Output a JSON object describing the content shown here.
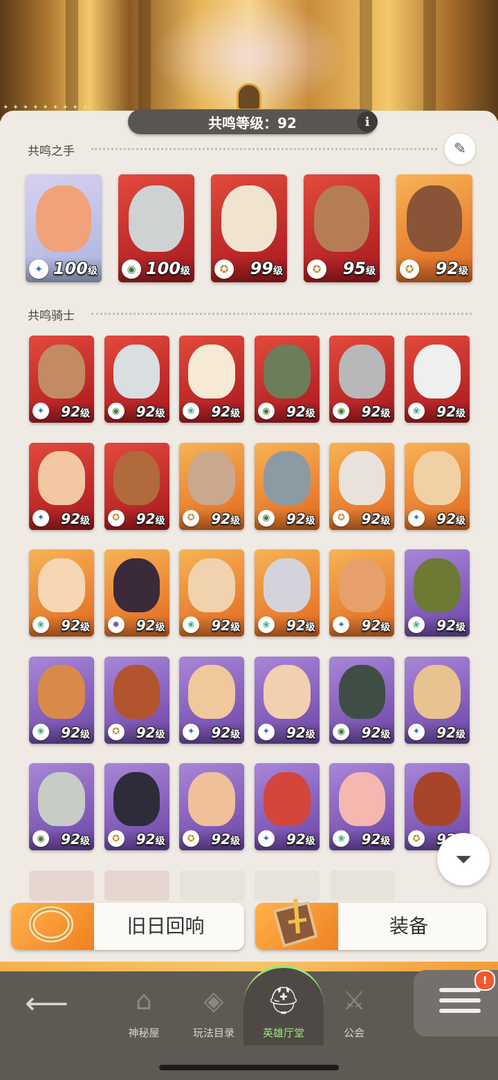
{
  "header": {
    "resonance_label": "共鸣等级：92",
    "info_glyph": "i"
  },
  "sections": {
    "hands_title": "共鸣之手",
    "knights_title": "共鸣骑士"
  },
  "hands": [
    {
      "level": "100",
      "unit": "级",
      "bg": "white",
      "face": "#f2a27a",
      "emblem": "✦",
      "emblem_color": "#3c6dd8"
    },
    {
      "level": "100",
      "unit": "级",
      "bg": "red",
      "face": "#cfd2d3",
      "emblem": "◉",
      "emblem_color": "#4a7a3c"
    },
    {
      "level": "99",
      "unit": "级",
      "bg": "red",
      "face": "#f1e4cf",
      "emblem": "✪",
      "emblem_color": "#c98a2a"
    },
    {
      "level": "95",
      "unit": "级",
      "bg": "red",
      "face": "#b57d56",
      "emblem": "✪",
      "emblem_color": "#c98a2a"
    },
    {
      "level": "92",
      "unit": "级",
      "bg": "orange",
      "face": "#8a5436",
      "emblem": "✪",
      "emblem_color": "#c98a2a"
    }
  ],
  "knights": [
    {
      "level": "92",
      "unit": "级",
      "bg": "red",
      "face": "#c28b64",
      "emblem": "✦",
      "emblem_color": "#3c6dd8"
    },
    {
      "level": "92",
      "unit": "级",
      "bg": "red",
      "face": "#d9dfe0",
      "emblem": "◉",
      "emblem_color": "#4a7a3c"
    },
    {
      "level": "92",
      "unit": "级",
      "bg": "red",
      "face": "#f6ead4",
      "emblem": "❀",
      "emblem_color": "#3aa87a"
    },
    {
      "level": "92",
      "unit": "级",
      "bg": "red",
      "face": "#6c7d5a",
      "emblem": "◉",
      "emblem_color": "#4a7a3c"
    },
    {
      "level": "92",
      "unit": "级",
      "bg": "red",
      "face": "#b8b8ba",
      "emblem": "◉",
      "emblem_color": "#4a7a3c"
    },
    {
      "level": "92",
      "unit": "级",
      "bg": "red",
      "face": "#f0efef",
      "emblem": "❀",
      "emblem_color": "#3aa87a"
    },
    {
      "level": "92",
      "unit": "级",
      "bg": "red",
      "face": "#f4c7a3",
      "emblem": "✦",
      "emblem_color": "#3c6dd8"
    },
    {
      "level": "92",
      "unit": "级",
      "bg": "red",
      "face": "#b06a3c",
      "emblem": "✪",
      "emblem_color": "#c98a2a"
    },
    {
      "level": "92",
      "unit": "级",
      "bg": "orange",
      "face": "#c9a88e",
      "emblem": "✪",
      "emblem_color": "#c98a2a"
    },
    {
      "level": "92",
      "unit": "级",
      "bg": "orange",
      "face": "#8c9aa4",
      "emblem": "◉",
      "emblem_color": "#4a7a3c"
    },
    {
      "level": "92",
      "unit": "级",
      "bg": "orange",
      "face": "#e9e2dc",
      "emblem": "✪",
      "emblem_color": "#c98a2a"
    },
    {
      "level": "92",
      "unit": "级",
      "bg": "orange",
      "face": "#f2d0a6",
      "emblem": "✦",
      "emblem_color": "#3c6dd8"
    },
    {
      "level": "92",
      "unit": "级",
      "bg": "orange",
      "face": "#f6d6b3",
      "emblem": "❀",
      "emblem_color": "#3aa87a"
    },
    {
      "level": "92",
      "unit": "级",
      "bg": "orange",
      "face": "#3a2a3a",
      "emblem": "✹",
      "emblem_color": "#7a4ac8"
    },
    {
      "level": "92",
      "unit": "级",
      "bg": "orange",
      "face": "#f0d2ac",
      "emblem": "❀",
      "emblem_color": "#3aa87a"
    },
    {
      "level": "92",
      "unit": "级",
      "bg": "orange",
      "face": "#d3d3dc",
      "emblem": "❀",
      "emblem_color": "#3aa87a"
    },
    {
      "level": "92",
      "unit": "级",
      "bg": "orange",
      "face": "#e8a06a",
      "emblem": "✦",
      "emblem_color": "#3c6dd8"
    },
    {
      "level": "92",
      "unit": "级",
      "bg": "purple",
      "face": "#6d7a34",
      "emblem": "❀",
      "emblem_color": "#3aa87a"
    },
    {
      "level": "92",
      "unit": "级",
      "bg": "purple",
      "face": "#d98a4a",
      "emblem": "❀",
      "emblem_color": "#3aa87a"
    },
    {
      "level": "92",
      "unit": "级",
      "bg": "purple",
      "face": "#b2542e",
      "emblem": "✪",
      "emblem_color": "#c98a2a"
    },
    {
      "level": "92",
      "unit": "级",
      "bg": "purple",
      "face": "#f0c89c",
      "emblem": "✦",
      "emblem_color": "#3c6dd8"
    },
    {
      "level": "92",
      "unit": "级",
      "bg": "purple",
      "face": "#f2cfae",
      "emblem": "✦",
      "emblem_color": "#3c6dd8"
    },
    {
      "level": "92",
      "unit": "级",
      "bg": "purple",
      "face": "#3e4e44",
      "emblem": "◉",
      "emblem_color": "#4a7a3c"
    },
    {
      "level": "92",
      "unit": "级",
      "bg": "purple",
      "face": "#e8c290",
      "emblem": "✦",
      "emblem_color": "#3c6dd8"
    },
    {
      "level": "92",
      "unit": "级",
      "bg": "purple",
      "face": "#c7ccc6",
      "emblem": "◉",
      "emblem_color": "#4a7a3c"
    },
    {
      "level": "92",
      "unit": "级",
      "bg": "purple",
      "face": "#2f2c3a",
      "emblem": "✪",
      "emblem_color": "#c98a2a"
    },
    {
      "level": "92",
      "unit": "级",
      "bg": "purple",
      "face": "#f0c09a",
      "emblem": "✪",
      "emblem_color": "#c98a2a"
    },
    {
      "level": "92",
      "unit": "级",
      "bg": "purple",
      "face": "#d4453c",
      "emblem": "✦",
      "emblem_color": "#3c6dd8"
    },
    {
      "level": "92",
      "unit": "级",
      "bg": "purple",
      "face": "#f5b7b0",
      "emblem": "❀",
      "emblem_color": "#3aa87a"
    },
    {
      "level": "92",
      "unit": "级",
      "bg": "purple",
      "face": "#a8442a",
      "emblem": "✪",
      "emblem_color": "#c98a2a"
    }
  ],
  "buttons": {
    "echo_label": "旧日回响",
    "equip_label": "装备"
  },
  "nav": {
    "items": [
      {
        "label": "神秘屋",
        "icon": "mystery-house-icon",
        "glyph": "⌂"
      },
      {
        "label": "玩法目录",
        "icon": "modes-catalog-icon",
        "glyph": "◈"
      },
      {
        "label": "英雄厅堂",
        "icon": "hero-hall-icon",
        "glyph": "⛑"
      },
      {
        "label": "公会",
        "icon": "guild-icon",
        "glyph": "⚔"
      }
    ],
    "badge": "!"
  },
  "colors": {
    "active_green": "#9ce37a",
    "nav_bg": "#5f5954",
    "accent_orange": "#f29c36"
  }
}
